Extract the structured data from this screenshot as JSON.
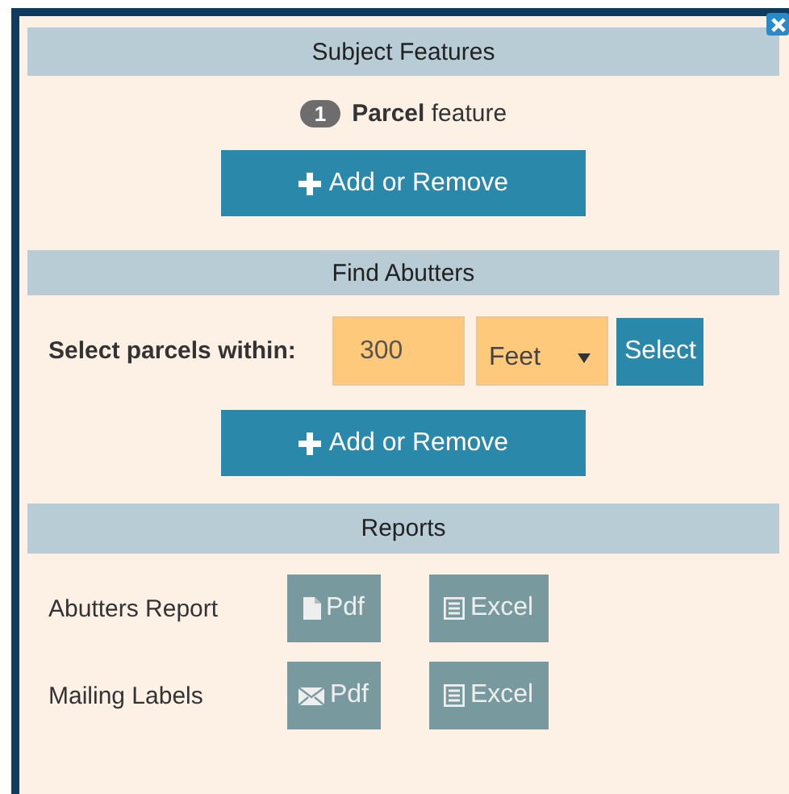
{
  "subject": {
    "title": "Subject Features",
    "count": "1",
    "feature_label": "**Parcel** feature",
    "button": "Add or Remove"
  },
  "abutters": {
    "title": "Find Abutters",
    "label": "Select parcels within:",
    "distance": "300",
    "unit": "Feet",
    "select_button": "Select",
    "button": "Add or Remove"
  },
  "reports": {
    "title": "Reports",
    "rows": [
      {
        "label": "Abutters Report",
        "buttons": [
          {
            "kind": "document",
            "label": "Pdf",
            "disabled": true
          },
          {
            "kind": "sheet",
            "label": "Excel",
            "disabled": true
          }
        ]
      },
      {
        "label": "Mailing Labels",
        "buttons": [
          {
            "kind": "mail",
            "label": "Pdf",
            "disabled": true
          },
          {
            "kind": "sheet",
            "label": "Excel",
            "disabled": true
          }
        ]
      }
    ]
  }
}
